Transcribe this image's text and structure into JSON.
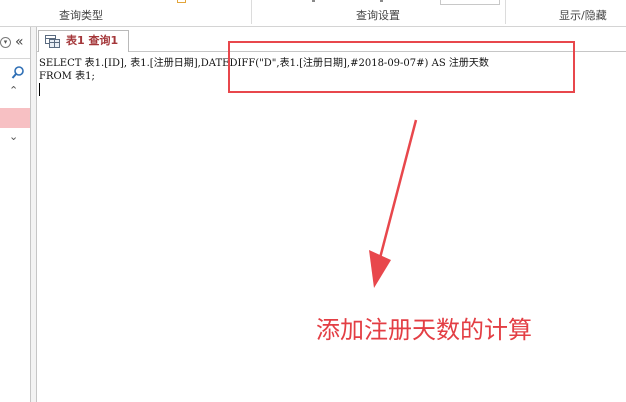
{
  "ribbon": {
    "groups": [
      {
        "label": "查询类型"
      },
      {
        "label": "查询设置"
      },
      {
        "label": "显示/隐藏"
      }
    ]
  },
  "nav_pane": {
    "collapse_glyph": "«",
    "dropdown_glyph": "▾",
    "search_icon": "search-icon",
    "scroll_up_glyph": "⌃",
    "scroll_down_glyph": "⌄",
    "selected_color": "#f7c0c3"
  },
  "document": {
    "tab_label": "表1 查询1",
    "tab_color": "#a4373a",
    "sql_lines": [
      "SELECT 表1.[ID], 表1.[注册日期],DATEDIFF(\"D\",表1.[注册日期],#2018-09-07#) AS 注册天数",
      "FROM 表1;"
    ]
  },
  "annotation": {
    "text": "添加注册天数的计算",
    "color": "#e33e44"
  }
}
